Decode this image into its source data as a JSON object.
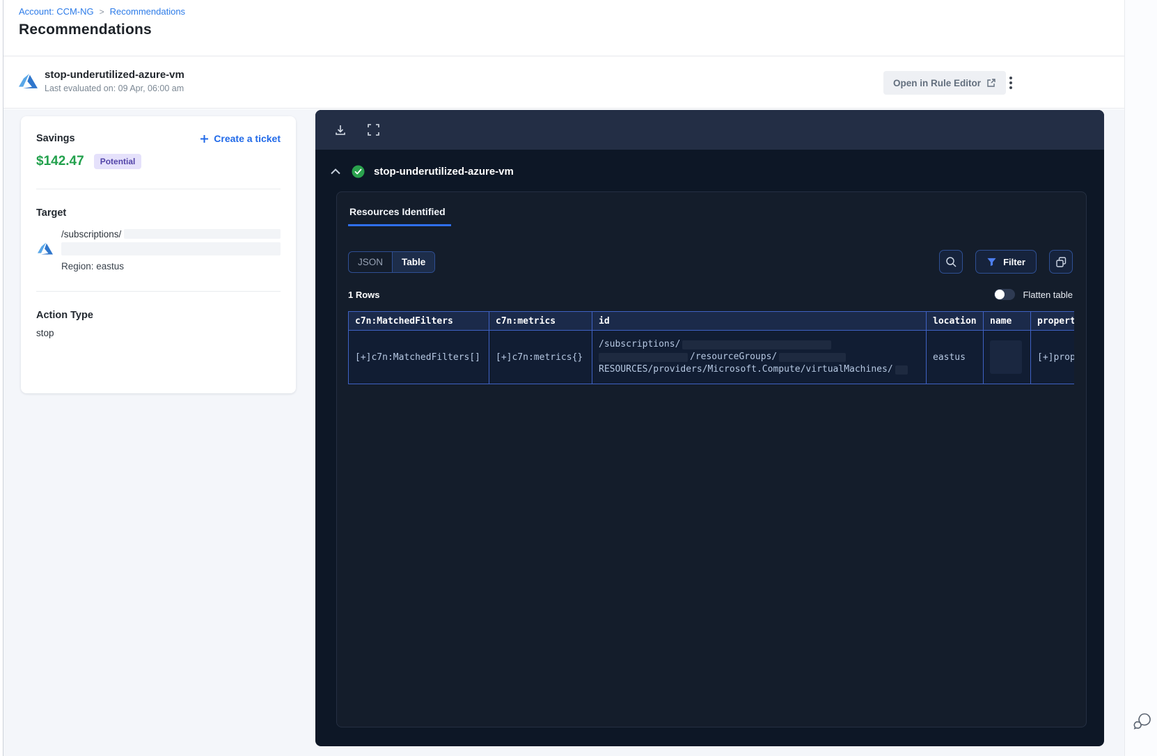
{
  "breadcrumb": {
    "account": "Account: CCM-NG",
    "separator": ">",
    "current": "Recommendations"
  },
  "page_title": "Recommendations",
  "rule_header": {
    "name": "stop-underutilized-azure-vm",
    "last_evaluated": "Last evaluated on: 09 Apr, 06:00 am",
    "open_in_rule_editor": "Open in Rule Editor"
  },
  "savings_card": {
    "savings_label": "Savings",
    "amount": "$142.47",
    "badge": "Potential",
    "create_ticket": "Create a ticket",
    "target_label": "Target",
    "target_path": "/subscriptions/",
    "target_region": "Region: eastus",
    "action_type_label": "Action Type",
    "action_type_value": "stop"
  },
  "results_panel": {
    "rule_name": "stop-underutilized-azure-vm",
    "tab_label": "Resources Identified",
    "view_options": {
      "json": "JSON",
      "table": "Table",
      "selected": "Table"
    },
    "filter_button": "Filter",
    "rows_count": "1 Rows",
    "flatten_toggle": {
      "label": "Flatten table",
      "state": "off"
    },
    "table": {
      "columns": {
        "c0": "c7n:MatchedFilters",
        "c1": "c7n:metrics",
        "c2": "id",
        "c3": "location",
        "c4": "name",
        "c5": "propert"
      },
      "row": {
        "c7n_matched_filters": "[+]c7n:MatchedFilters[]",
        "c7n_metrics": "[+]c7n:metrics{}",
        "id_line_1": "/subscriptions/",
        "id_line_2": "/resourceGroups/",
        "id_line_3": "RESOURCES/providers/Microsoft.Compute/virtualMachines/",
        "location": "eastus",
        "name": "",
        "properties": "[+]prop"
      }
    }
  },
  "icons": {
    "toolbar": [
      "download-icon",
      "fullscreen-icon"
    ],
    "controls": [
      "search-icon",
      "filter-funnel-icon",
      "copy-icon"
    ],
    "misc": [
      "azure-logo",
      "check-circle-icon",
      "chevron-up-icon",
      "kebab-menu-icon",
      "external-link-icon",
      "plus-icon",
      "chat-help-icon"
    ]
  },
  "colors": {
    "accent_blue": "#2c7be8",
    "savings_green": "#23a14d",
    "badge_bg": "#e5e1fb",
    "badge_text": "#5244a8",
    "panel_bg": "#0d1726",
    "panel_toolbar_bg": "#232e45",
    "table_border": "#3f62c4",
    "tab_underline": "#2f6fed",
    "check_green": "#2aa24d"
  }
}
